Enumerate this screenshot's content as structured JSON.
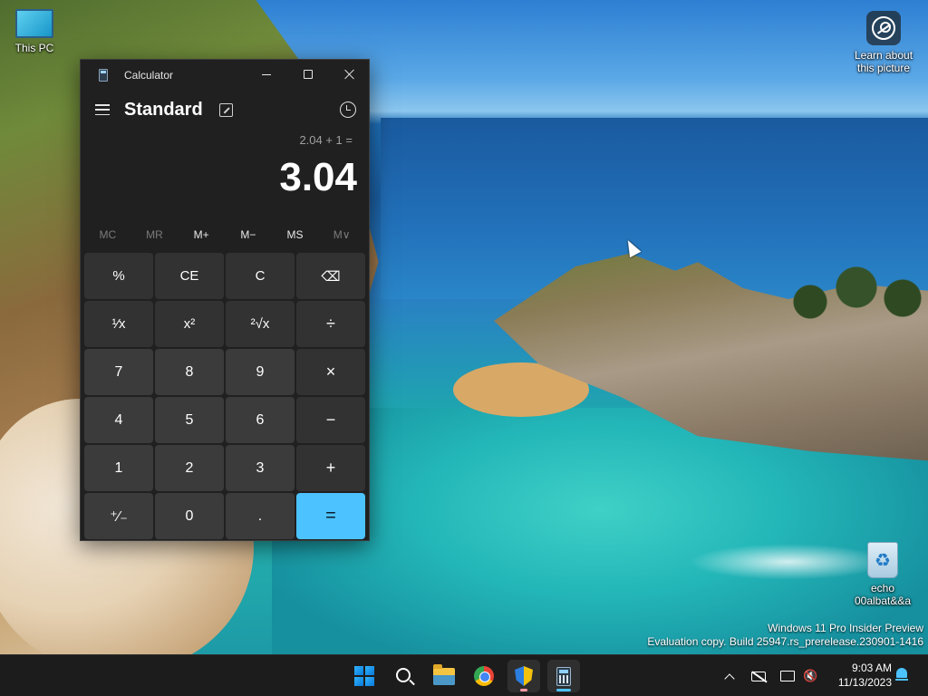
{
  "desktop": {
    "icons": {
      "this_pc": "This PC",
      "learn": "Learn about\nthis picture",
      "learn_line1": "Learn about",
      "learn_line2": "this picture",
      "recycle_line1": "echo",
      "recycle_line2": "00albat&&a"
    },
    "watermark": {
      "line1": "Windows 11 Pro Insider Preview",
      "line2": "Evaluation copy. Build 25947.rs_prerelease.230901-1416"
    }
  },
  "calculator": {
    "window_title": "Calculator",
    "mode": "Standard",
    "expression": "2.04 + 1 =",
    "result": "3.04",
    "memory_buttons": [
      {
        "label": "MC",
        "enabled": false
      },
      {
        "label": "MR",
        "enabled": false
      },
      {
        "label": "M+",
        "enabled": true
      },
      {
        "label": "M−",
        "enabled": true
      },
      {
        "label": "MS",
        "enabled": true
      },
      {
        "label": "M∨",
        "enabled": false
      }
    ],
    "keys": [
      [
        "%",
        "CE",
        "C",
        "⌫"
      ],
      [
        "¹⁄x",
        "x²",
        "²√x",
        "÷"
      ],
      [
        "7",
        "8",
        "9",
        "×"
      ],
      [
        "4",
        "5",
        "6",
        "−"
      ],
      [
        "1",
        "2",
        "3",
        "+"
      ],
      [
        "⁺⁄₋",
        "0",
        ".",
        "="
      ]
    ]
  },
  "taskbar": {
    "time": "9:03 AM",
    "date": "11/13/2023",
    "apps": [
      "start-icon",
      "search-icon",
      "file-explorer-icon",
      "chrome-icon",
      "security-shield-icon",
      "calculator-icon"
    ]
  },
  "colors": {
    "accent": "#4cc2ff",
    "window_bg": "#202020",
    "key_bg": "#3b3b3b",
    "taskbar_bg": "#1c1c1c"
  }
}
